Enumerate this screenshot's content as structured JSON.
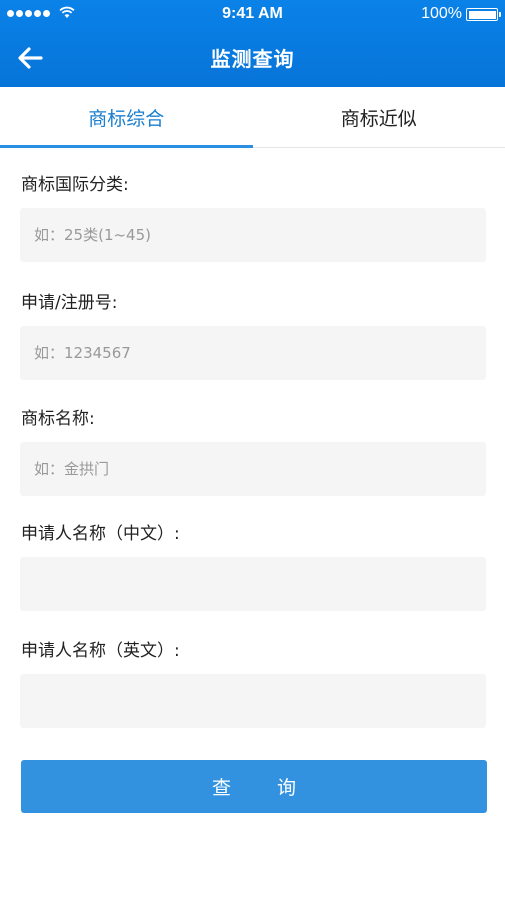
{
  "status_bar": {
    "time": "9:41 AM",
    "battery": "100%",
    "signal_icon": "signal-dots-icon",
    "wifi_icon": "wifi-icon",
    "battery_icon": "battery-icon"
  },
  "nav": {
    "title": "监测查询",
    "back_icon": "arrow-left-icon"
  },
  "tabs": [
    {
      "label": "商标综合",
      "active": true
    },
    {
      "label": "商标近似",
      "active": false
    }
  ],
  "form": {
    "fields": [
      {
        "label": "商标国际分类:",
        "value": "",
        "placeholder": "如：25类(1~45)"
      },
      {
        "label": "申请/注册号:",
        "value": "",
        "placeholder": "如：1234567"
      },
      {
        "label": "商标名称:",
        "value": "",
        "placeholder": "如：金拱门"
      },
      {
        "label": "申请人名称（中文）:",
        "value": "",
        "placeholder": ""
      },
      {
        "label": "申请人名称（英文）:",
        "value": "",
        "placeholder": ""
      }
    ],
    "submit_label": "查 询"
  },
  "colors": {
    "header_blue": "#0a7ce2",
    "accent_blue": "#2a8fe0",
    "button_blue": "#3292e0",
    "input_bg": "#f5f5f5"
  }
}
